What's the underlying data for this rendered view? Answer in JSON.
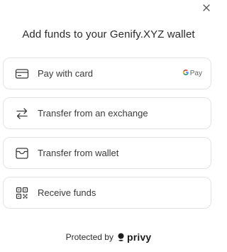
{
  "modal": {
    "title": "Add funds to your Genify.XYZ wallet",
    "close_icon": "close-icon"
  },
  "options": [
    {
      "label": "Pay with card",
      "icon": "credit-card-icon",
      "badge": "G Pay"
    },
    {
      "label": "Transfer from an exchange",
      "icon": "transfer-arrows-icon"
    },
    {
      "label": "Transfer from wallet",
      "icon": "wallet-icon"
    },
    {
      "label": "Receive funds",
      "icon": "qr-code-icon"
    }
  ],
  "gpay": {
    "g": "G",
    "pay": "Pay"
  },
  "footer": {
    "protected_by": "Protected by",
    "brand": "privy"
  }
}
